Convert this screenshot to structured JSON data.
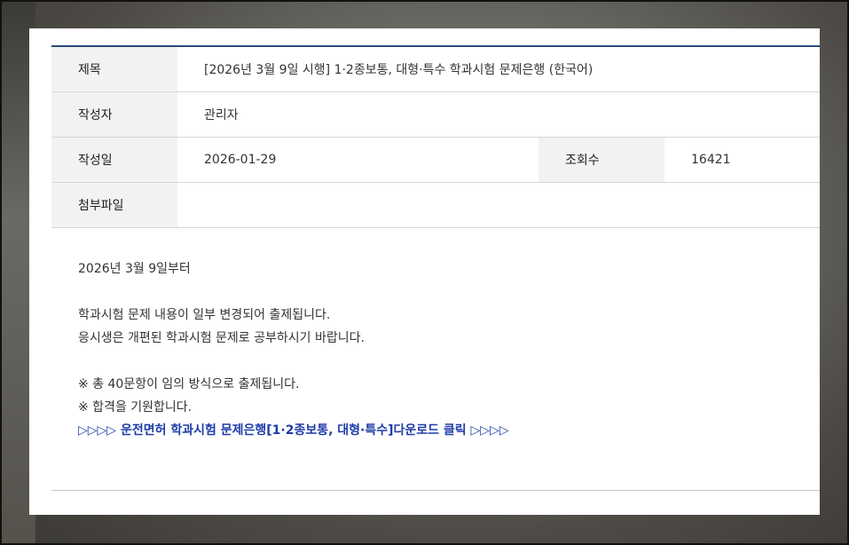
{
  "post": {
    "title_label": "제목",
    "title": "[2026년 3월 9일 시행] 1·2종보통, 대형·특수 학과시험 문제은행 (한국어)",
    "author_label": "작성자",
    "author": "관리자",
    "date_label": "작성일",
    "date": "2026-01-29",
    "views_label": "조회수",
    "views": "16421",
    "attachment_label": "첨부파일",
    "attachment": ""
  },
  "body": {
    "line1": "2026년 3월 9일부터",
    "line2": "학과시험 문제 내용이 일부 변경되어 출제됩니다.",
    "line3": "응시생은 개편된 학과시험 문제로 공부하시기 바랍니다.",
    "line4": "※ 총 40문항이 임의 방식으로 출제됩니다.",
    "line5": "※ 합격을 기원합니다.",
    "download_link": "▷▷▷▷ 운전면허 학과시험 문제은행[1·2종보통, 대형·특수]다운로드 클릭 ▷▷▷▷"
  }
}
